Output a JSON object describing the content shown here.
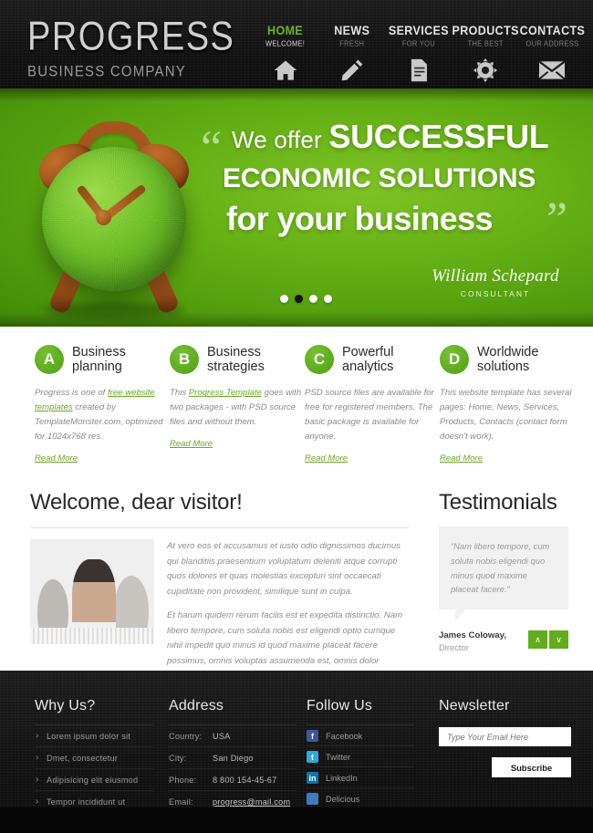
{
  "header": {
    "logo_main": "PROGRESS",
    "logo_sub": "BUSINESS COMPANY",
    "nav": [
      {
        "title": "HOME",
        "sub": "WELCOME!",
        "icon": "home-icon",
        "active": true
      },
      {
        "title": "NEWS",
        "sub": "FRESH",
        "icon": "pencil-icon",
        "active": false
      },
      {
        "title": "SERVICES",
        "sub": "FOR YOU",
        "icon": "document-icon",
        "active": false
      },
      {
        "title": "PRODUCTS",
        "sub": "THE BEST",
        "icon": "gear-icon",
        "active": false
      },
      {
        "title": "CONTACTS",
        "sub": "OUR ADDRESS",
        "icon": "envelope-icon",
        "active": false
      }
    ]
  },
  "hero": {
    "quote_open": "“",
    "quote_close": "”",
    "line1_lead": "We offer",
    "line1_strong": "SUCCESSFUL",
    "line2": "ECONOMIC SOLUTIONS",
    "line3": "for your business",
    "signature_name": "William Schepard",
    "signature_role": "CONSULTANT",
    "slider_dots": 4,
    "slider_active_index": 1,
    "image_alt": "grass-alarm-clock-image"
  },
  "features": [
    {
      "badge": "A",
      "title_line1": "Business",
      "title_line2": "planning",
      "body_parts": [
        {
          "text": "Progress is one of ",
          "link": false
        },
        {
          "text": "free website templates",
          "link": true
        },
        {
          "text": " created by TemplateMonster.com, optimized for 1024x768 res.",
          "link": false
        }
      ],
      "read_more": "Read More"
    },
    {
      "badge": "B",
      "title_line1": "Business",
      "title_line2": "strategies",
      "body_parts": [
        {
          "text": "This ",
          "link": false
        },
        {
          "text": "Progress Template",
          "link": true
        },
        {
          "text": " goes with two packages - with PSD source files and without them.",
          "link": false
        }
      ],
      "read_more": "Read More"
    },
    {
      "badge": "C",
      "title_line1": "Powerful",
      "title_line2": "analytics",
      "body_parts": [
        {
          "text": "PSD source files are available for free for registered members. The basic package is available for anyone.",
          "link": false
        }
      ],
      "read_more": "Read More"
    },
    {
      "badge": "D",
      "title_line1": "Worldwide",
      "title_line2": "solutions",
      "body_parts": [
        {
          "text": "This website template has several pages: Home, News, Services, Products, Contacts (contact form doesn't work).",
          "link": false
        }
      ],
      "read_more": "Read More"
    }
  ],
  "welcome": {
    "title": "Welcome, dear visitor!",
    "paragraph1": "At vero eos et accusamus et iusto odio dignissimos ducimus qui blanditiis praesentium voluptatum deleniti atque corrupti quos dolores et quas molestias excepturi sint occaecati cupiditate non provident, similique sunt in culpa.",
    "paragraph2": "Et harum quidem rerum facilis est et expedita distinctio. Nam libero tempore, cum soluta nobis est eligendi optio cumque nihil impedit quo minus id quod maxime placeat facere possimus, omnis voluptas assumenda est, omnis dolor repellendus.",
    "photo_alt": "team-photo"
  },
  "testimonials": {
    "title": "Testimonials",
    "quote": "“Nam libero tempore, cum soluta nobis eligendi quo minus quod maxime placeat facere.”",
    "author": "James Coloway,",
    "role": "Director",
    "prev_label": "∧",
    "next_label": "∨"
  },
  "footer": {
    "why_us": {
      "title": "Why Us?",
      "items": [
        "Lorem ipsum dolor sit",
        "Dmet, consectetur",
        "Adipisicing elit eiusmod",
        "Tempor incididunt ut"
      ]
    },
    "address": {
      "title": "Address",
      "rows": [
        {
          "key": "Country:",
          "value": "USA",
          "link": false
        },
        {
          "key": "City:",
          "value": "San Diego",
          "link": false
        },
        {
          "key": "Phone:",
          "value": "8 800 154-45-67",
          "link": false
        },
        {
          "key": "Email:",
          "value": "progress@mail.com",
          "link": true
        }
      ]
    },
    "follow_us": {
      "title": "Follow Us",
      "items": [
        {
          "label": "Facebook",
          "icon": "facebook-icon",
          "color": "#3b5998",
          "glyph": "f"
        },
        {
          "label": "Twitter",
          "icon": "twitter-icon",
          "color": "#2daae1",
          "glyph": "t"
        },
        {
          "label": "LinkedIn",
          "icon": "linkedin-icon",
          "color": "#0e76a8",
          "glyph": "in"
        },
        {
          "label": "Delicious",
          "icon": "delicious-icon",
          "color": "#3b7bbf",
          "glyph": ""
        }
      ]
    },
    "newsletter": {
      "title": "Newsletter",
      "placeholder": "Type Your Email Here",
      "value": "",
      "button": "Subscribe"
    }
  },
  "colors": {
    "accent_green": "#62ad1d",
    "hero_green": "#63ae14",
    "dark": "#141414",
    "link_green": "#6aa828"
  }
}
